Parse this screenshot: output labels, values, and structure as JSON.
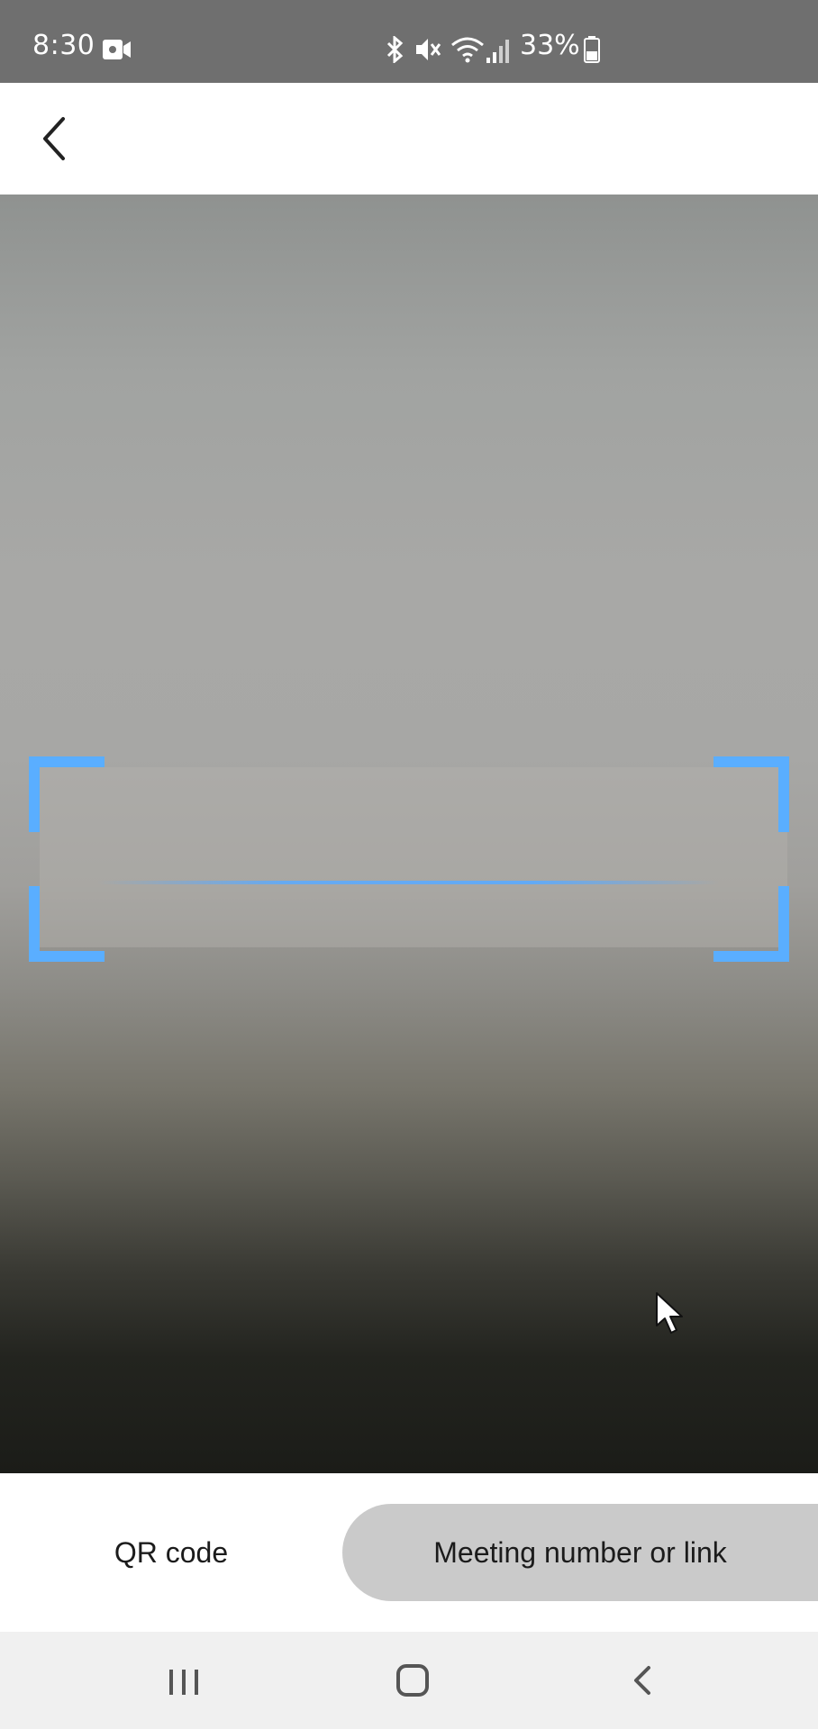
{
  "status_bar": {
    "time": "8:30",
    "battery_percent": "33%",
    "icons": [
      "video-call-icon",
      "bluetooth-icon",
      "mute-icon",
      "wifi-icon",
      "signal-icon",
      "battery-icon"
    ],
    "background_color": "#6f6f6f"
  },
  "header": {
    "back_icon": "chevron-left-icon"
  },
  "scanner": {
    "frame_color": "#5aaeff"
  },
  "tabs": [
    {
      "label": "QR code",
      "selected": false
    },
    {
      "label": "Meeting number or link",
      "selected": true
    }
  ],
  "nav_bar": {
    "icons": [
      "recents-icon",
      "home-icon",
      "back-icon"
    ]
  }
}
